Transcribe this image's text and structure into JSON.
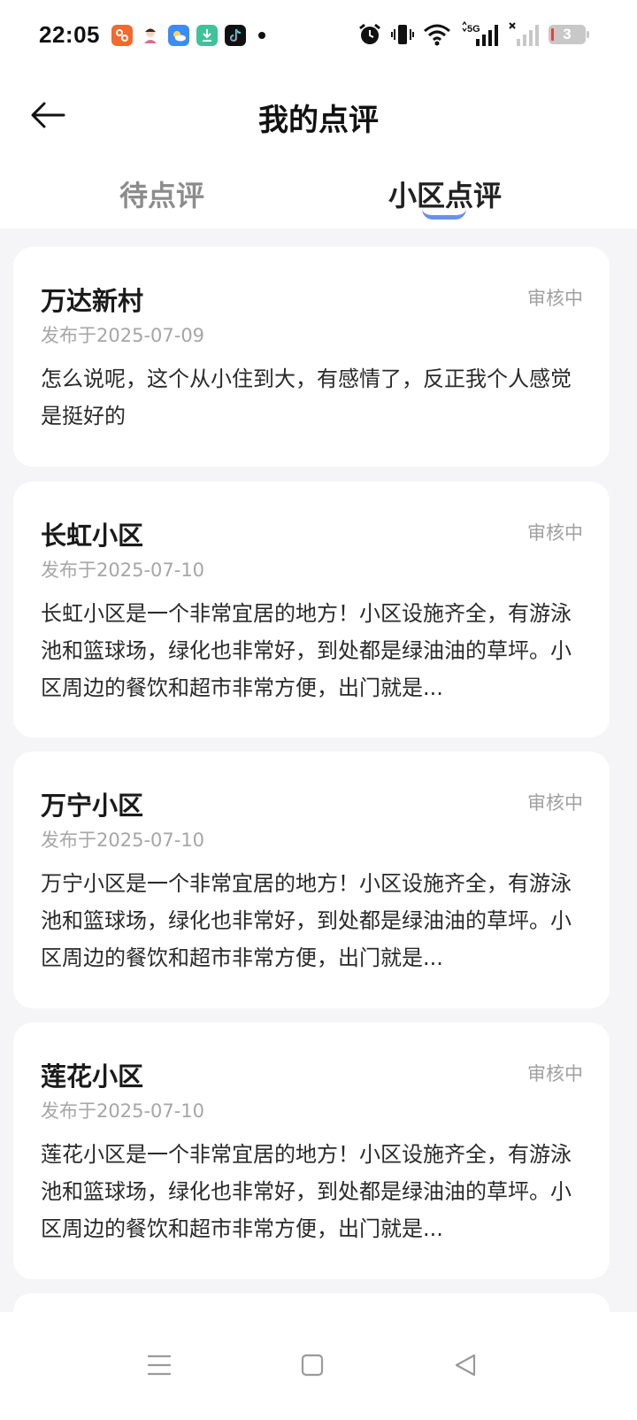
{
  "status_bar": {
    "time": "22:05",
    "apps": [
      {
        "icon": "taobao-app-icon",
        "color": "#f26a2e"
      },
      {
        "icon": "avatar-app-icon",
        "color": "#ffffff"
      },
      {
        "icon": "weather-app-icon",
        "color": "#3b8cf5"
      },
      {
        "icon": "download-app-icon",
        "color": "#3fc29a"
      },
      {
        "icon": "douyin-app-icon",
        "color": "#111111"
      }
    ],
    "network": "5G",
    "battery": "3"
  },
  "header": {
    "title": "我的点评",
    "back_icon": "back-arrow-icon"
  },
  "tabs": {
    "pending": "待点评",
    "community": "小区点评",
    "active": "community",
    "accent_color": "#4f7df0"
  },
  "reviews": [
    {
      "title": "万达新村",
      "status": "审核中",
      "date": "发布于2025-07-09",
      "content": "怎么说呢，这个从小住到大，有感情了，反正我个人感觉是挺好的"
    },
    {
      "title": "长虹小区",
      "status": "审核中",
      "date": "发布于2025-07-10",
      "content": "长虹小区是一个非常宜居的地方！小区设施齐全，有游泳池和篮球场，绿化也非常好，到处都是绿油油的草坪。小区周边的餐饮和超市非常方便，出门就是..."
    },
    {
      "title": "万宁小区",
      "status": "审核中",
      "date": "发布于2025-07-10",
      "content": "万宁小区是一个非常宜居的地方！小区设施齐全，有游泳池和篮球场，绿化也非常好，到处都是绿油油的草坪。小区周边的餐饮和超市非常方便，出门就是..."
    },
    {
      "title": "莲花小区",
      "status": "审核中",
      "date": "发布于2025-07-10",
      "content": "莲花小区是一个非常宜居的地方！小区设施齐全，有游泳池和篮球场，绿化也非常好，到处都是绿油油的草坪。小区周边的餐饮和超市非常方便，出门就是..."
    }
  ],
  "nav_bar": {
    "menu_icon": "menu-icon",
    "home_icon": "home-icon",
    "back_icon": "back-triangle-icon"
  }
}
